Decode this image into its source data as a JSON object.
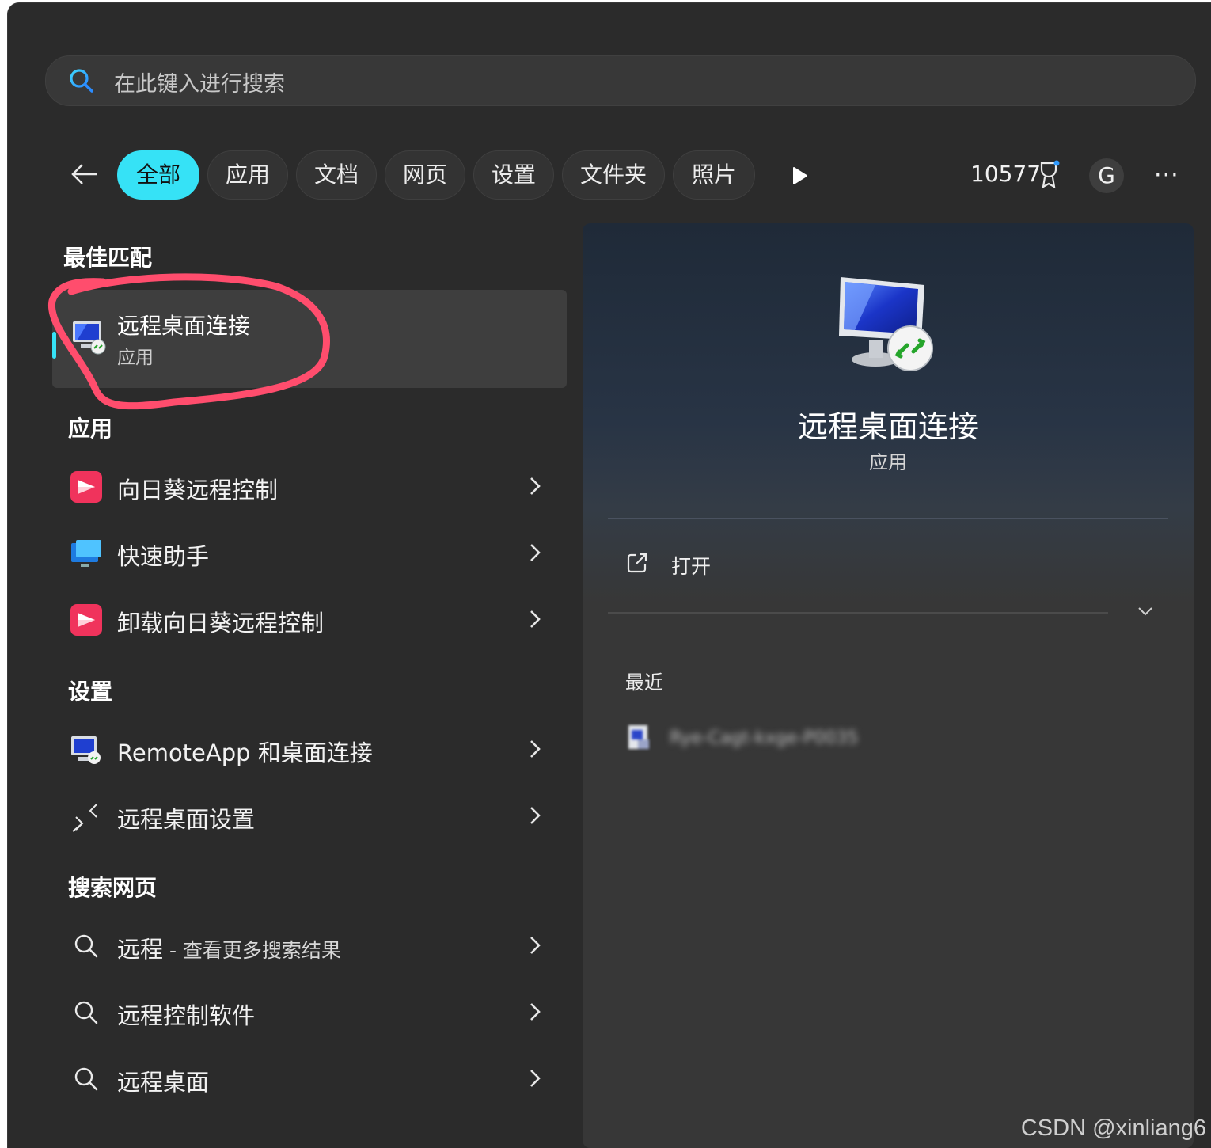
{
  "search": {
    "placeholder": "在此键入进行搜索"
  },
  "filters": {
    "tabs": [
      {
        "label": "全部",
        "active": true
      },
      {
        "label": "应用"
      },
      {
        "label": "文档"
      },
      {
        "label": "网页"
      },
      {
        "label": "设置"
      },
      {
        "label": "文件夹"
      },
      {
        "label": "照片"
      }
    ],
    "points": "10577",
    "avatar_initial": "G",
    "more": "···"
  },
  "best_match": {
    "header": "最佳匹配",
    "title": "远程桌面连接",
    "subtitle": "应用"
  },
  "apps": {
    "header": "应用",
    "items": [
      {
        "label": "向日葵远程控制",
        "icon": "sunlogin-icon"
      },
      {
        "label": "快速助手",
        "icon": "quick-assist-icon"
      },
      {
        "label": "卸载向日葵远程控制",
        "icon": "sunlogin-icon"
      }
    ]
  },
  "settings": {
    "header": "设置",
    "items": [
      {
        "label": "RemoteApp 和桌面连接",
        "icon": "remote-desktop-icon"
      },
      {
        "label": "远程桌面设置",
        "icon": "remote-arrows-icon"
      }
    ]
  },
  "web": {
    "header": "搜索网页",
    "items": [
      {
        "label": "远程",
        "suffix": " - 查看更多搜索结果"
      },
      {
        "label": "远程控制软件"
      },
      {
        "label": "远程桌面"
      }
    ]
  },
  "detail": {
    "title": "远程桌面连接",
    "subtitle": "应用",
    "open_label": "打开",
    "recent_header": "最近",
    "recent_item": "Rye-Cagt-kxge-P0035"
  },
  "watermark": "CSDN @xinliang6",
  "colors": {
    "accent": "#36e2f6",
    "annotation": "#ff4d6d",
    "background": "#2b2b2b"
  }
}
